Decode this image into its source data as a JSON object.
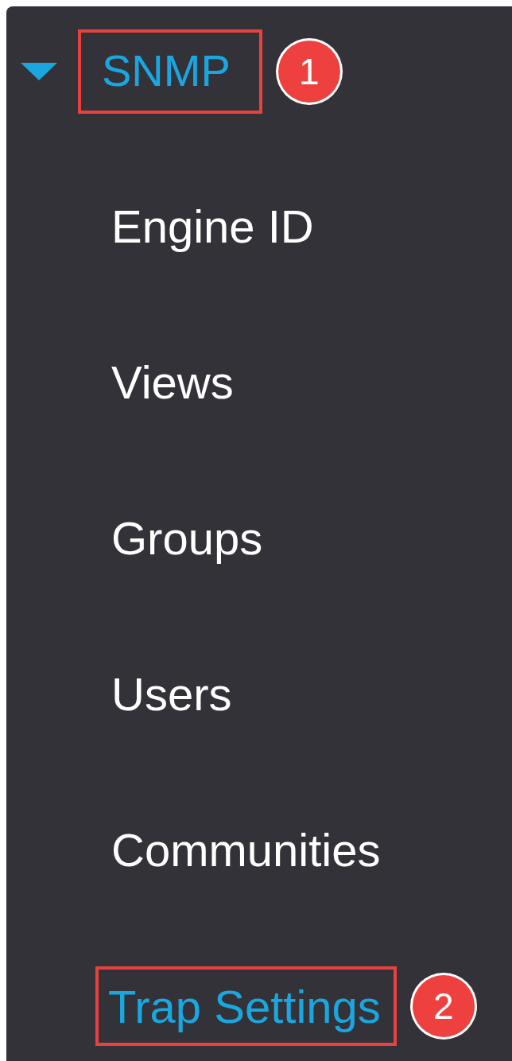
{
  "menu": {
    "label": "SNMP",
    "expanded": true,
    "active": true,
    "callout": "1",
    "children": [
      {
        "label": "Engine ID",
        "selected": false
      },
      {
        "label": "Views",
        "selected": false
      },
      {
        "label": "Groups",
        "selected": false
      },
      {
        "label": "Users",
        "selected": false
      },
      {
        "label": "Communities",
        "selected": false
      },
      {
        "label": "Trap Settings",
        "selected": true,
        "callout": "2"
      }
    ]
  }
}
